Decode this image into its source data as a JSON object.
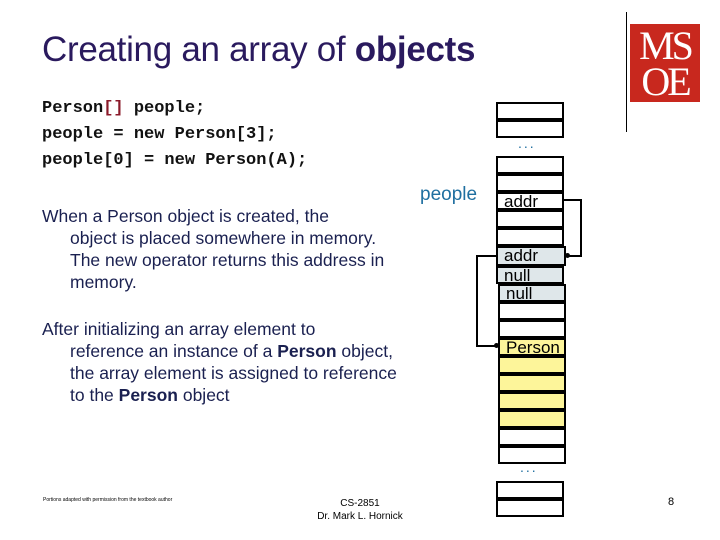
{
  "slide": {
    "title_plain": "Creating an array of ",
    "title_bold": "objects",
    "logo_line1": "MS",
    "logo_line2": "OE",
    "code": {
      "line1_a": "Person",
      "line1_brackets": "[]",
      "line1_b": " people;",
      "line2": "people = new Person[3];",
      "line3": "people[0] = new Person(A);"
    },
    "paragraph1": {
      "first": "When a Person object is created, the",
      "rest": "object is placed somewhere in memory. The new operator returns this address in memory."
    },
    "paragraph2": {
      "first": "After initializing an array element to",
      "rest_a": "reference an instance of a ",
      "bold1": "Person",
      "rest_b": " object, the array element is assigned to reference to the ",
      "bold2": "Person",
      "rest_c": " object"
    },
    "memory": {
      "variable_label": "people",
      "ellipsis": "...",
      "cells": {
        "people_var": "addr",
        "array_0": "addr",
        "array_1": "null",
        "array_2": "null",
        "person_obj": "Person"
      }
    },
    "footer": {
      "left": "Portions adapted with permission from the textbook author",
      "course": "CS-2851",
      "instructor": "Dr. Mark L. Hornick",
      "page_number": "8"
    }
  }
}
